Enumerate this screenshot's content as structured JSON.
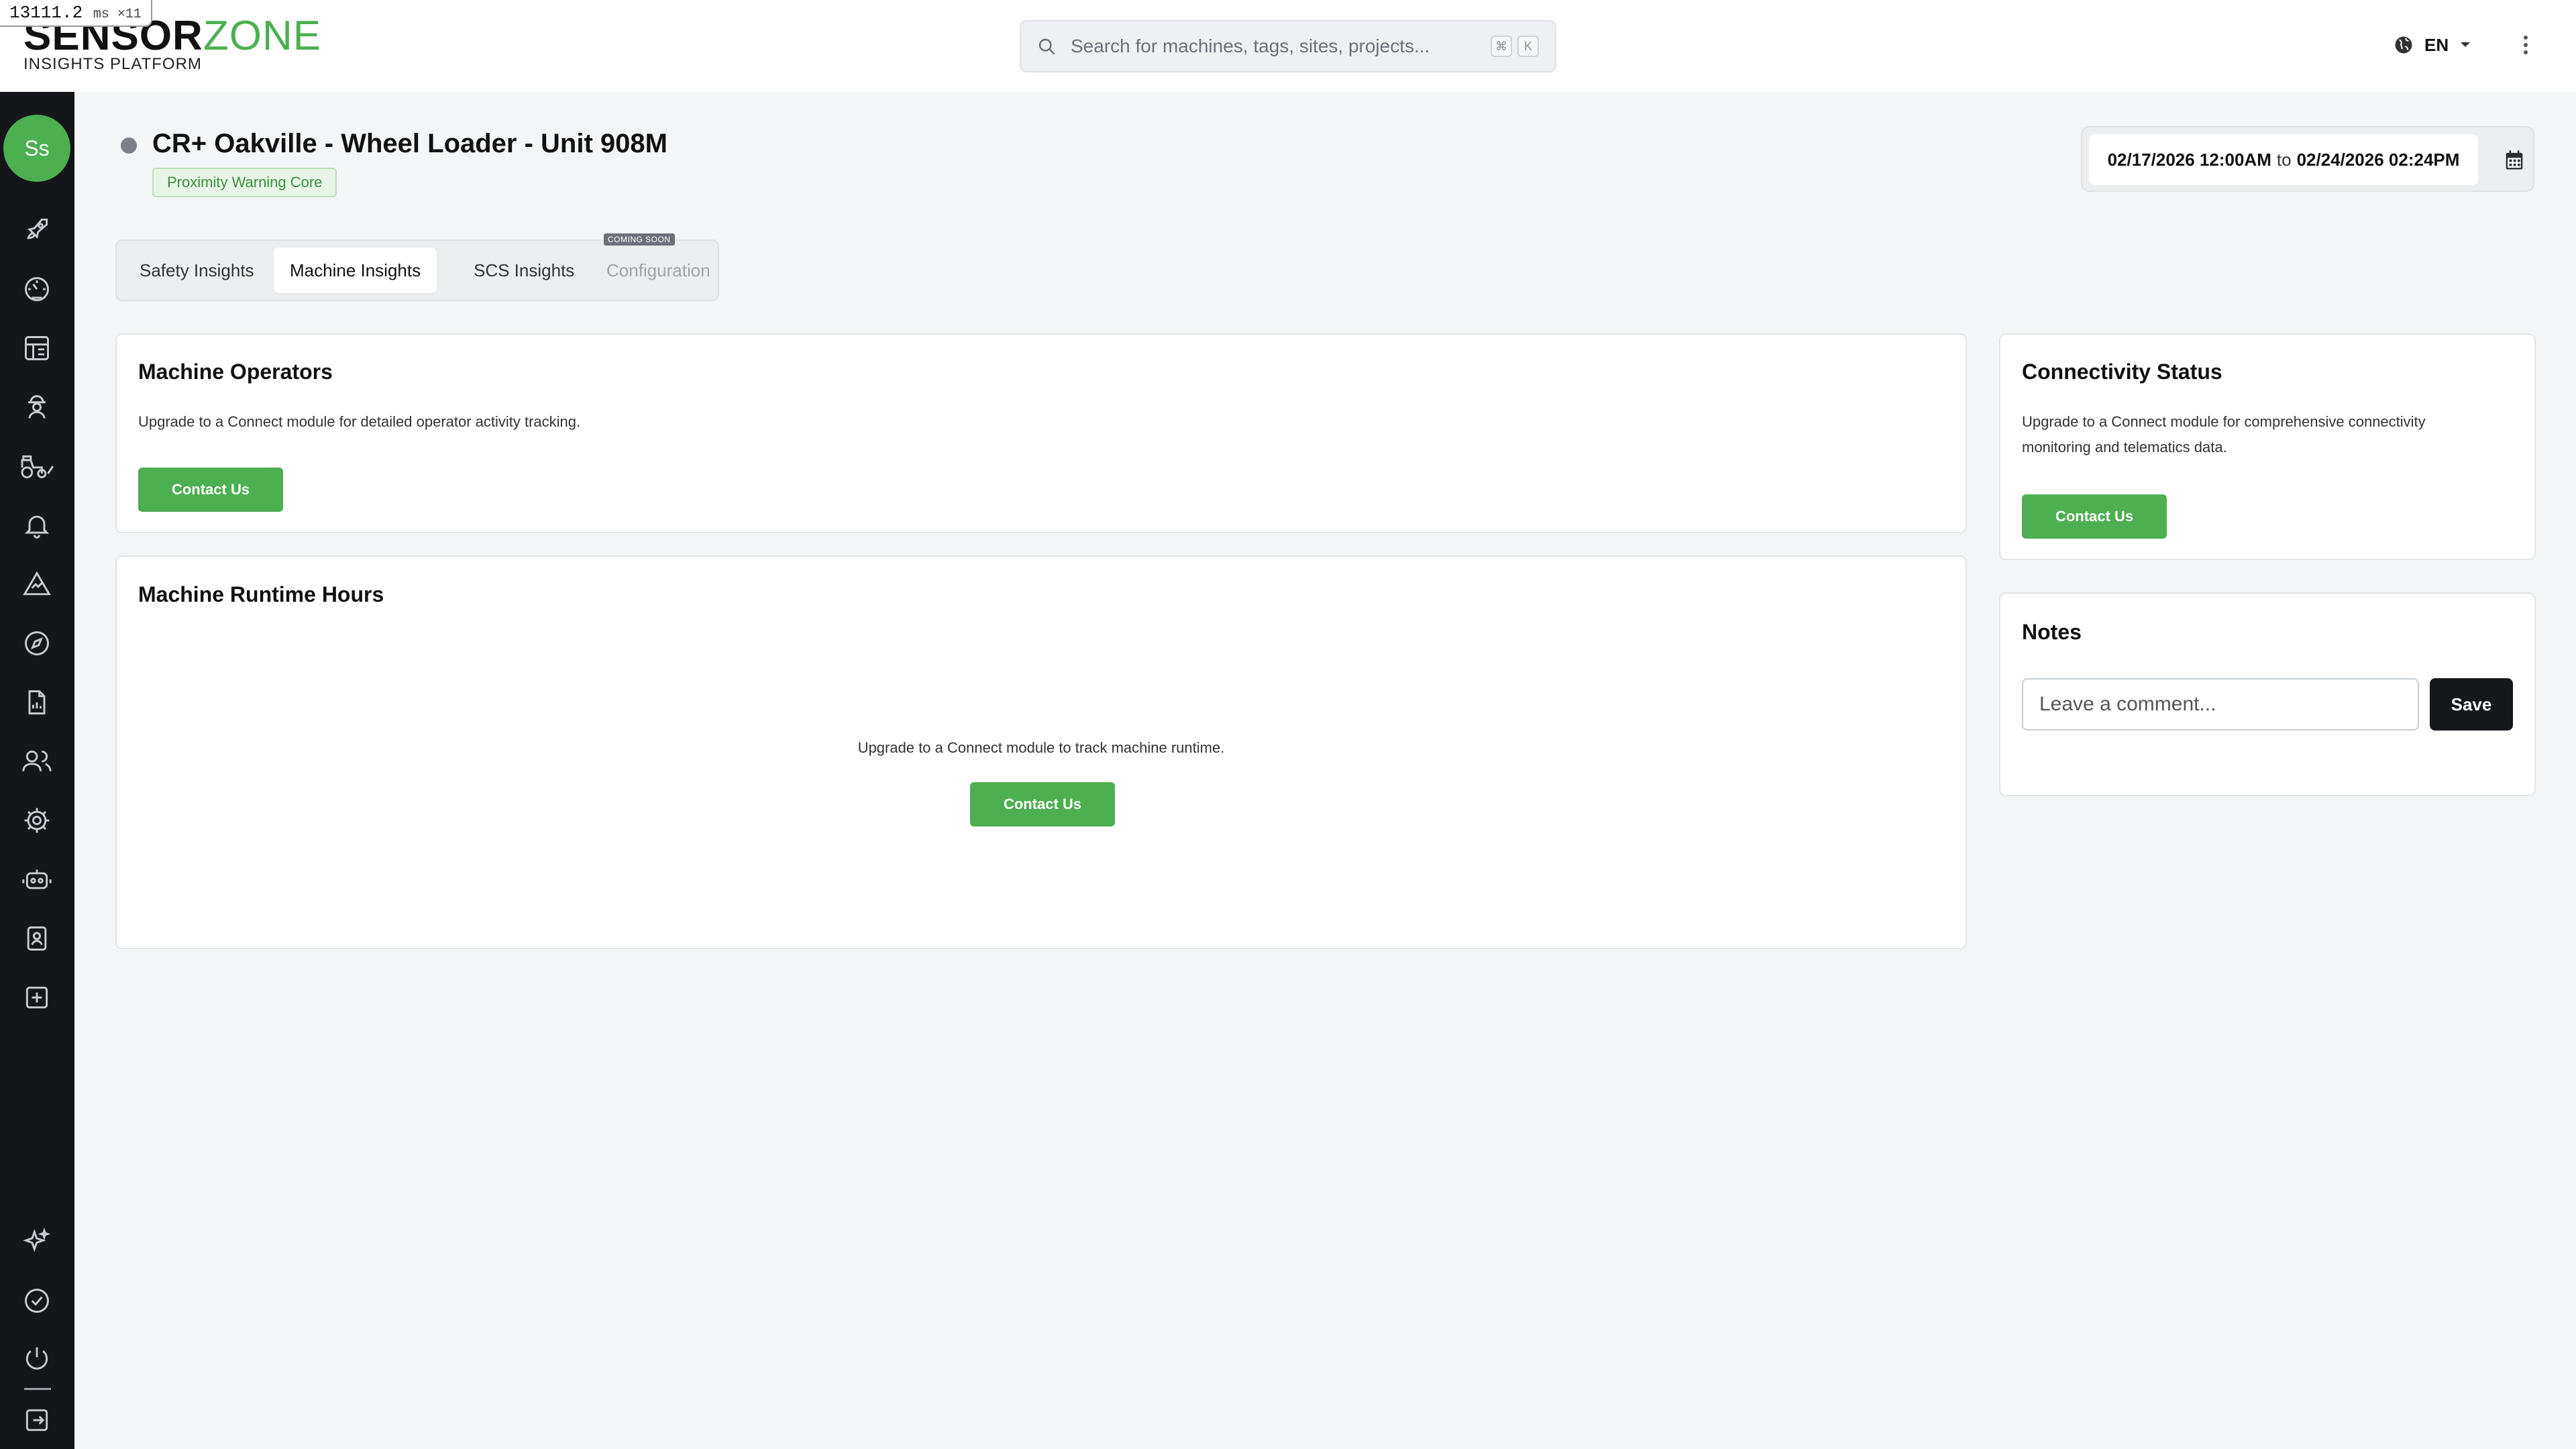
{
  "perf_badge": {
    "value": "13111.2",
    "unit": "ms ×11"
  },
  "logo": {
    "brand_left": "SENSOR",
    "brand_right": "ZONE",
    "subtitle": "INSIGHTS PLATFORM"
  },
  "search": {
    "placeholder": "Search for machines, tags, sites, projects...",
    "shortcut_keys": [
      "⌘",
      "K"
    ]
  },
  "language": {
    "code": "EN"
  },
  "sidebar": {
    "avatar_initials": "Ss",
    "items": [
      {
        "icon": "rocket-icon"
      },
      {
        "icon": "gauge-icon"
      },
      {
        "icon": "dashboard-icon"
      },
      {
        "icon": "worker-icon"
      },
      {
        "icon": "tractor-icon"
      },
      {
        "icon": "bell-icon"
      },
      {
        "icon": "hazard-icon"
      },
      {
        "icon": "compass-icon"
      },
      {
        "icon": "report-icon"
      },
      {
        "icon": "users-icon"
      },
      {
        "icon": "gear-icon"
      },
      {
        "icon": "robot-icon"
      },
      {
        "icon": "badge-icon"
      },
      {
        "icon": "add-box-icon"
      }
    ],
    "bottom_items": [
      {
        "icon": "sparkles-icon"
      },
      {
        "icon": "check-circle-icon"
      },
      {
        "icon": "power-icon"
      },
      {
        "icon": "logout-icon"
      }
    ]
  },
  "page": {
    "title": "CR+ Oakville - Wheel Loader - Unit 908M",
    "badge": "Proximity Warning Core"
  },
  "date_range": {
    "start": "02/17/2026 12:00AM",
    "separator": "to",
    "end": "02/24/2026 02:24PM"
  },
  "tabs": [
    {
      "label": "Safety Insights",
      "state": "normal"
    },
    {
      "label": "Machine Insights",
      "state": "active"
    },
    {
      "label": "SCS Insights",
      "state": "normal"
    },
    {
      "label": "Configuration",
      "state": "disabled"
    }
  ],
  "coming_soon_label": "COMING SOON",
  "cards": {
    "operators": {
      "title": "Machine Operators",
      "message": "Upgrade to a Connect module for detailed operator activity tracking.",
      "button": "Contact Us"
    },
    "runtime": {
      "title": "Machine Runtime Hours",
      "message": "Upgrade to a Connect module to track machine runtime.",
      "button": "Contact Us"
    },
    "connectivity": {
      "title": "Connectivity Status",
      "message_line1": "Upgrade to a Connect module for comprehensive connectivity",
      "message_line2": "monitoring and telematics data.",
      "button": "Contact Us"
    },
    "notes": {
      "title": "Notes",
      "placeholder": "Leave a comment...",
      "save": "Save"
    }
  },
  "colors": {
    "accent": "#4caf50",
    "sidebar_bg": "#141619",
    "page_bg": "#f4f5f6"
  }
}
